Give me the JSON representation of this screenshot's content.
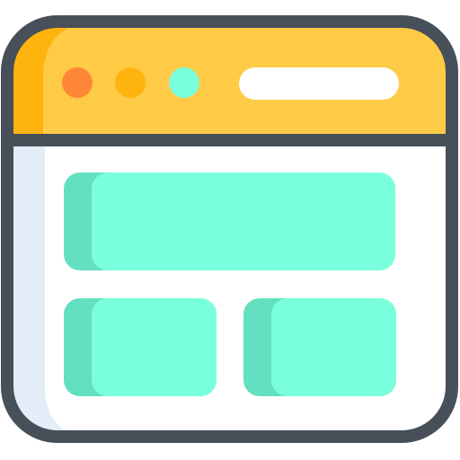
{
  "icon": {
    "name": "browser-window-layout-icon",
    "colors": {
      "outline": "#474f59",
      "titlebar": "#ffcb47",
      "titlebar_shade": "#ffb30f",
      "body": "#ffffff",
      "body_shade": "#e4ecf7",
      "block": "#7affdc",
      "block_shade": "#62e0c0",
      "dot_close": "#ff8636",
      "dot_minimize": "#ffb30f",
      "dot_maximize": "#7affdc",
      "address_bar": "#ffffff"
    }
  }
}
